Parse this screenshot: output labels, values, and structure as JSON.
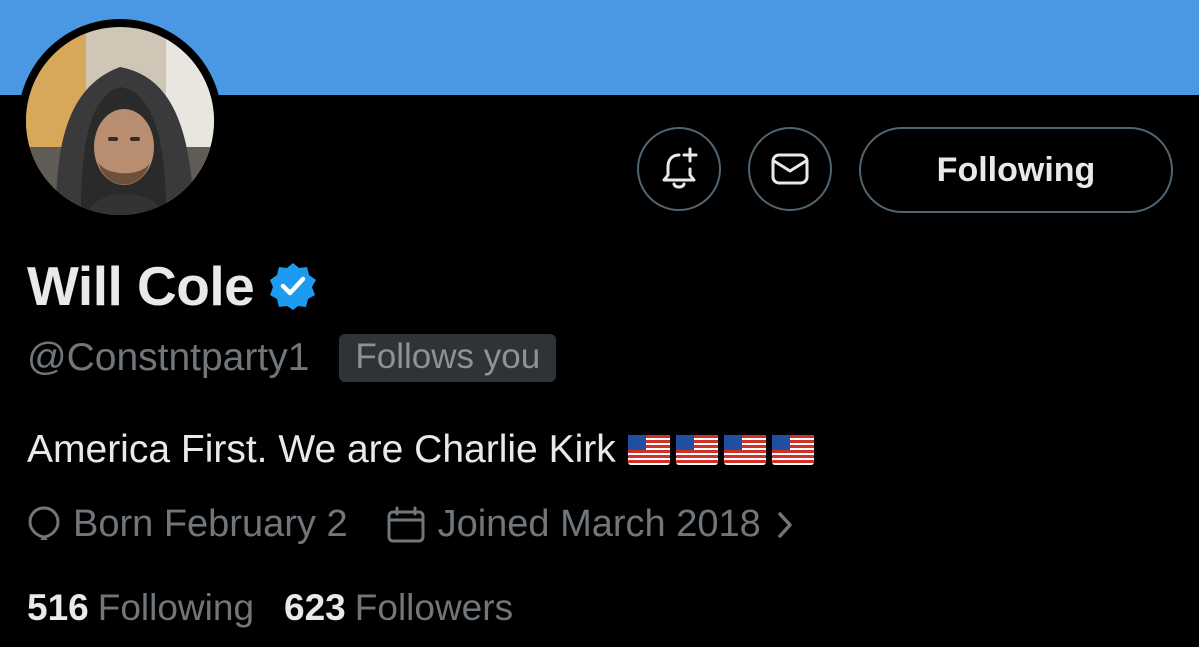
{
  "profile": {
    "display_name": "Will Cole",
    "handle": "@Constntparty1",
    "follows_you_badge": "Follows you",
    "bio": "America First. We are Charlie Kirk",
    "bio_emoji": [
      "us-flag",
      "us-flag",
      "us-flag",
      "us-flag"
    ],
    "birthday": "Born February 2",
    "joined": "Joined March 2018",
    "following_count": "516",
    "following_label": "Following",
    "followers_count": "623",
    "followers_label": "Followers",
    "verified": true
  },
  "actions": {
    "notify_icon": "bell-plus-icon",
    "message_icon": "envelope-icon",
    "following_button_label": "Following"
  },
  "icons": {
    "birthday": "balloon-icon",
    "joined": "calendar-icon",
    "joined_more": "chevron-right-icon",
    "verified": "verified-badge-icon"
  },
  "colors": {
    "banner": "#4a98e3",
    "background": "#000000",
    "verified_blue": "#1d9bf0",
    "primary_text": "#e7e9ea",
    "secondary_text": "#71767b"
  }
}
